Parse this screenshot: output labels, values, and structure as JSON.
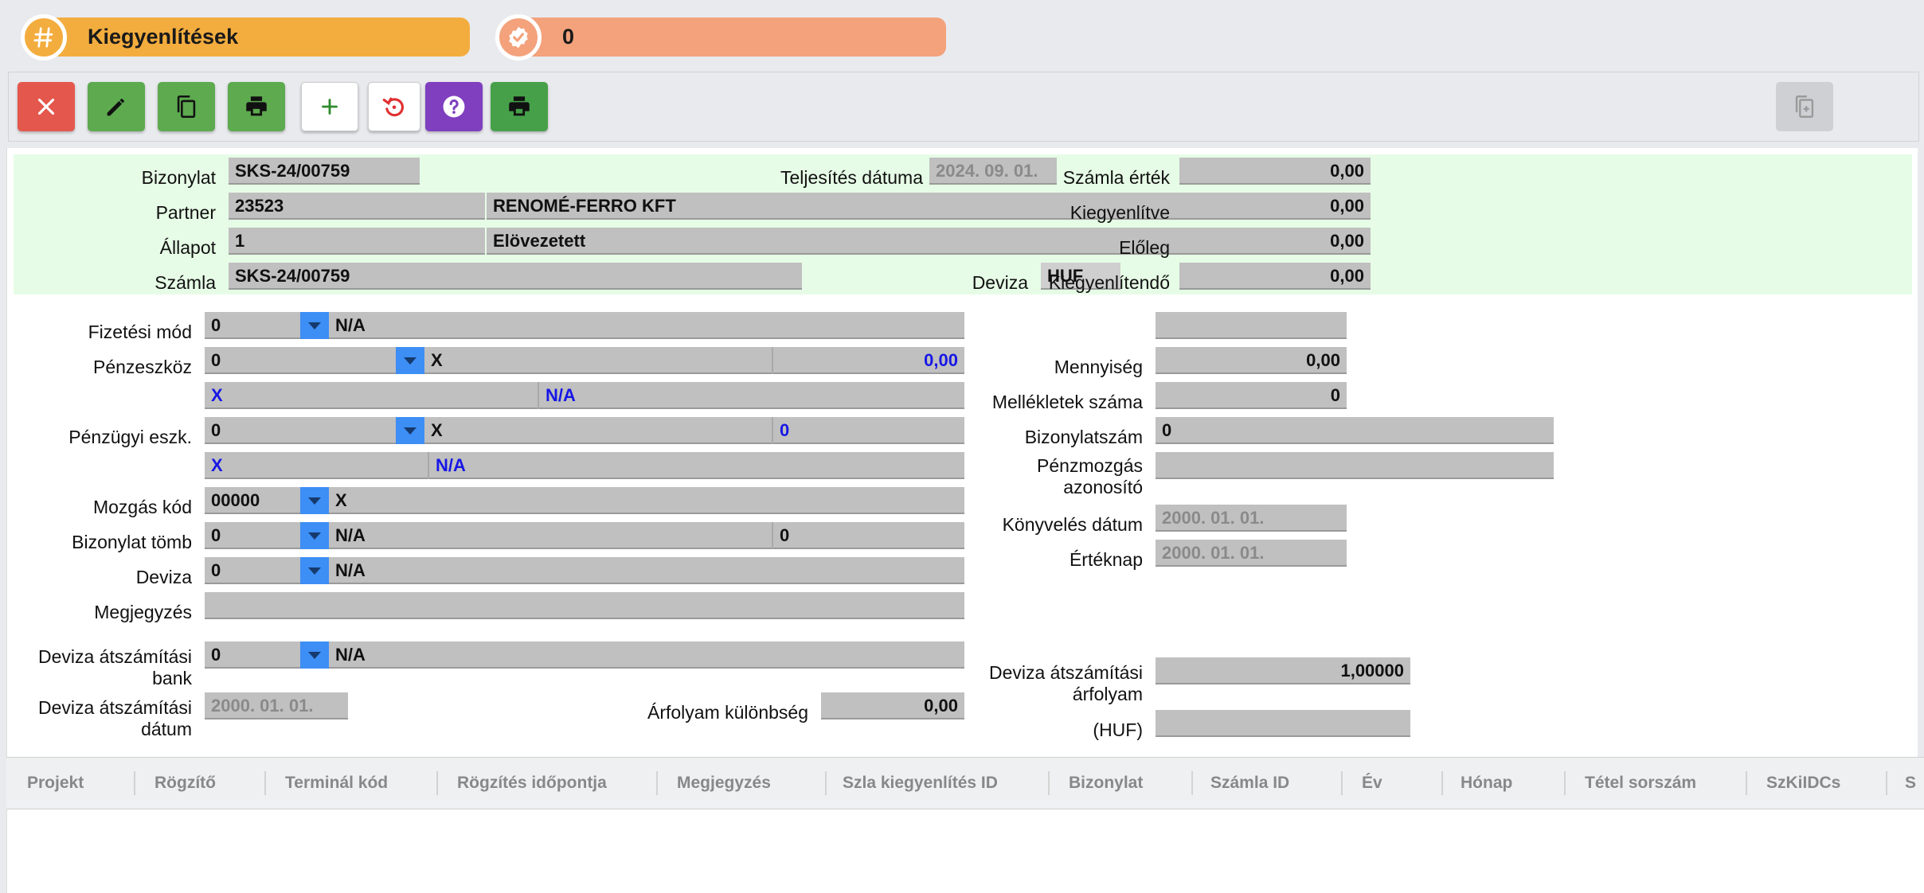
{
  "header": {
    "title": "Kiegyenlítések",
    "counter": "0",
    "colors": {
      "title_pill": "#f3ad3e",
      "counter_pill": "#f3a27c"
    }
  },
  "toolbar": {
    "buttons": [
      {
        "name": "close-button",
        "icon": "close-icon",
        "color": "#e4574d"
      },
      {
        "name": "edit-button",
        "icon": "pencil-icon",
        "color": "#5daa4f"
      },
      {
        "name": "copy-button",
        "icon": "copy-icon",
        "color": "#5daa4f"
      },
      {
        "name": "print-button",
        "icon": "printer-icon",
        "color": "#5daa4f"
      },
      {
        "name": "add-button",
        "icon": "plus-icon",
        "color": "#ffffff"
      },
      {
        "name": "reset-button",
        "icon": "refresh-icon",
        "color": "#ffffff"
      },
      {
        "name": "help-button",
        "icon": "help-icon",
        "color": "#7f3fbf"
      },
      {
        "name": "print2-button",
        "icon": "printer-icon",
        "color": "#46a049"
      },
      {
        "name": "document-button",
        "icon": "document-icon",
        "color": "#cfd0d3"
      }
    ]
  },
  "top": {
    "bizonylat_label": "Bizonylat",
    "bizonylat": "SKS-24/00759",
    "partner_label": "Partner",
    "partner_code": "23523",
    "partner_name": "RENOMÉ-FERRO KFT",
    "allapot_label": "Állapot",
    "allapot_code": "1",
    "allapot_name": "Elövezetett",
    "szamla_label": "Számla",
    "szamla": "SKS-24/00759",
    "teljesites_label": "Teljesítés dátuma",
    "teljesites": "2024. 09. 01.",
    "deviza_label": "Deviza",
    "deviza": "HUF",
    "szamla_ertek_label": "Számla érték",
    "szamla_ertek": "0,00",
    "kiegyenlitve_label": "Kiegyenlítve",
    "kiegyenlitve": "0,00",
    "eloleg_label": "Előleg",
    "eloleg": "0,00",
    "kiegyenlitendo_label": "Kiegyenlítendő",
    "kiegyenlitendo": "0,00"
  },
  "form": {
    "fizetesi_mod_label": "Fizetési mód",
    "fizetesi_mod_code": "0",
    "fizetesi_mod_name": "N/A",
    "penzeszkoz_label": "Pénzeszköz",
    "penzeszkoz_code": "0",
    "penzeszkoz_name": "X",
    "penzeszkoz_value": "0,00",
    "penzeszkoz_sub1": "X",
    "penzeszkoz_sub2": "N/A",
    "penzugyi_label": "Pénzügyi eszk.",
    "penzugyi_code": "0",
    "penzugyi_name": "X",
    "penzugyi_value": "0",
    "penzugyi_sub1": "X",
    "penzugyi_sub2": "N/A",
    "mozgas_label": "Mozgás kód",
    "mozgas_code": "00000",
    "mozgas_name": "X",
    "tomb_label": "Bizonylat tömb",
    "tomb_code": "0",
    "tomb_name": "N/A",
    "tomb_value": "0",
    "deviza_label": "Deviza",
    "deviza_code": "0",
    "deviza_name": "N/A",
    "megjegyzes_label": "Megjegyzés",
    "megjegyzes": "",
    "datb_label1": "Deviza átszámítási",
    "datb_label2": "bank",
    "datb_code": "0",
    "datb_name": "N/A",
    "datd_label1": "Deviza átszámítási",
    "datd_label2": "dátum",
    "datd": "2000. 01. 01.",
    "arfkul_label": "Árfolyam különbség",
    "arfkul": "0,00",
    "mennyiseg_label": "Mennyiség",
    "mennyiseg": "0,00",
    "mellekletek_label": "Mellékletek száma",
    "mellekletek": "0",
    "bizonylatszam_label": "Bizonylatszám",
    "bizonylatszam": "0",
    "penzmozgas_label1": "Pénzmozgás",
    "penzmozgas_label2": "azonosító",
    "penzmozgas": "",
    "konyveles_label": "Könyvelés dátum",
    "konyveles": "2000. 01. 01.",
    "erteknap_label": "Értéknap",
    "erteknap": "2000. 01. 01.",
    "datarf_label1": "Deviza átszámítási",
    "datarf_label2": "árfolyam",
    "datarf": "1,00000",
    "huf_label": "(HUF)",
    "huf": ""
  },
  "grid": {
    "columns": [
      "Projekt",
      "Rögzítő",
      "Terminál kód",
      "Rögzítés időpontja",
      "Megjegyzés",
      "Szla kiegyenlítés ID",
      "Bizonylat",
      "Számla ID",
      "Év",
      "Hónap",
      "Tétel sorszám",
      "SzKiIDCs",
      "S"
    ]
  }
}
